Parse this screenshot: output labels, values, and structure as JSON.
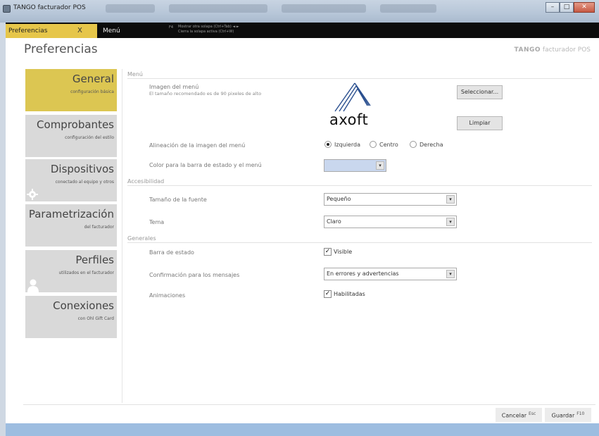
{
  "window": {
    "title": "TANGO facturador POS",
    "controls": {
      "minimize": "–",
      "maximize": "□",
      "close": "✕"
    }
  },
  "tabs": {
    "active_label": "Preferencias",
    "close_glyph": "X",
    "menu_label": "Menú",
    "tip_key": "F4",
    "tip_line1": "Mostrar otra solapa (Ctrl+Tab) ◄ ►",
    "tip_line2": "Cierra la solapa activa (Ctrl+W)"
  },
  "page": {
    "title": "Preferencias",
    "brand_logo": "TANGO",
    "brand_text": "facturador POS"
  },
  "nav": [
    {
      "title": "General",
      "subtitle": "configuración básica"
    },
    {
      "title": "Comprobantes",
      "subtitle": "configuración del estilo"
    },
    {
      "title": "Dispositivos",
      "subtitle": "conectado al equipo y otros"
    },
    {
      "title": "Parametrización",
      "subtitle": "del facturador"
    },
    {
      "title": "Perfiles",
      "subtitle": "utilizados en el facturador"
    },
    {
      "title": "Conexiones",
      "subtitle": "con Ohl Gift Card"
    }
  ],
  "sections": {
    "menu": "Menú",
    "accessibility": "Accesibilidad",
    "general": "Generales"
  },
  "menu_section": {
    "image_label": "Imagen del menú",
    "image_hint": "El tamaño recomendado es de 90 pixeles de alto",
    "logo_text": "axoft",
    "select_button": "Seleccionar...",
    "clear_button": "Limpiar",
    "align_label": "Alineación de la imagen del menú",
    "align_options": [
      "Izquierda",
      "Centro",
      "Derecha"
    ],
    "align_selected": "Izquierda",
    "color_label": "Color para la barra de estado y el menú",
    "color_value": "#c9d7ee"
  },
  "accessibility_section": {
    "font_size_label": "Tamaño de la fuente",
    "font_size_value": "Pequeño",
    "theme_label": "Tema",
    "theme_value": "Claro"
  },
  "general_section": {
    "statusbar_label": "Barra de estado",
    "statusbar_check": "Visible",
    "statusbar_checked": true,
    "confirm_label": "Confirmación para los mensajes",
    "confirm_value": "En errores y advertencias",
    "anim_label": "Animaciones",
    "anim_check": "Habilitadas",
    "anim_checked": true
  },
  "footer": {
    "cancel": "Cancelar",
    "cancel_key": "Esc",
    "save": "Guardar",
    "save_key": "F10"
  },
  "colors": {
    "accent_yellow": "#dcc652",
    "statusbar": "#9dbde0"
  }
}
